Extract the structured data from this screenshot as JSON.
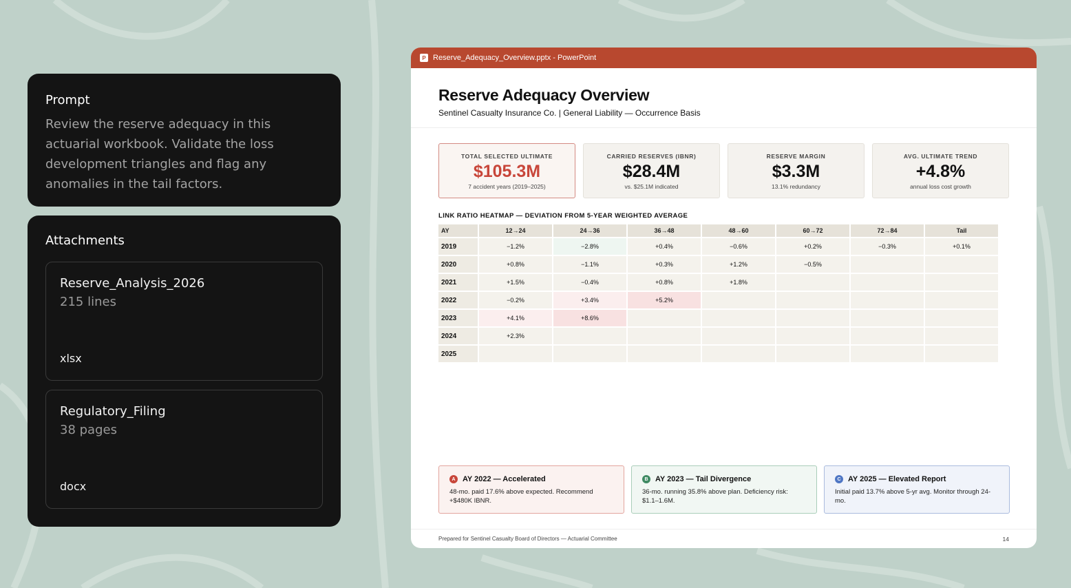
{
  "prompt": {
    "label": "Prompt",
    "text": "Review the reserve adequacy in this actuarial workbook. Validate the loss development triangles and flag any anomalies in the tail factors."
  },
  "attachments": {
    "label": "Attachments",
    "items": [
      {
        "name": "Reserve_Analysis_2026",
        "meta": "215 lines",
        "ext": "xlsx"
      },
      {
        "name": "Regulatory_Filing",
        "meta": "38 pages",
        "ext": "docx"
      }
    ]
  },
  "window": {
    "icon_letter": "P",
    "title": "Reserve_Adequacy_Overview.pptx - PowerPoint"
  },
  "slide": {
    "title": "Reserve Adequacy Overview",
    "subtitle": "Sentinel Casualty Insurance Co.  |  General Liability — Occurrence Basis",
    "kpis": [
      {
        "label": "TOTAL SELECTED ULTIMATE",
        "value": "$105.3M",
        "note": "7 accident years (2019–2025)"
      },
      {
        "label": "CARRIED RESERVES (IBNR)",
        "value": "$28.4M",
        "note": "vs. $25.1M indicated"
      },
      {
        "label": "RESERVE MARGIN",
        "value": "$3.3M",
        "note": "13.1% redundancy"
      },
      {
        "label": "AVG. ULTIMATE TREND",
        "value": "+4.8%",
        "note": "annual loss cost growth"
      }
    ],
    "heatmap": {
      "title": "LINK RATIO HEATMAP — DEVIATION FROM 5-YEAR WEIGHTED AVERAGE",
      "row_header": "AY",
      "columns": [
        "12→24",
        "24→36",
        "36→48",
        "48→60",
        "60→72",
        "72→84",
        "Tail"
      ],
      "rows": [
        {
          "ay": "2019",
          "cells": [
            "−1.2%",
            "−2.8%",
            "+0.4%",
            "−0.6%",
            "+0.2%",
            "−0.3%",
            "+0.1%"
          ]
        },
        {
          "ay": "2020",
          "cells": [
            "+0.8%",
            "−1.1%",
            "+0.3%",
            "+1.2%",
            "−0.5%",
            "",
            ""
          ]
        },
        {
          "ay": "2021",
          "cells": [
            "+1.5%",
            "−0.4%",
            "+0.8%",
            "+1.8%",
            "",
            "",
            ""
          ]
        },
        {
          "ay": "2022",
          "cells": [
            "−0.2%",
            "+3.4%",
            "+5.2%",
            "",
            "",
            "",
            ""
          ]
        },
        {
          "ay": "2023",
          "cells": [
            "+4.1%",
            "+8.6%",
            "",
            "",
            "",
            "",
            ""
          ]
        },
        {
          "ay": "2024",
          "cells": [
            "+2.3%",
            "",
            "",
            "",
            "",
            "",
            ""
          ]
        },
        {
          "ay": "2025",
          "cells": [
            "",
            "",
            "",
            "",
            "",
            "",
            ""
          ]
        }
      ]
    },
    "callouts": [
      {
        "badge": "A",
        "title": "AY 2022 — Accelerated",
        "body": "48-mo. paid 17.6% above expected. Recommend +$480K IBNR."
      },
      {
        "badge": "B",
        "title": "AY 2023 — Tail Divergence",
        "body": "36-mo. running 35.8% above plan. Deficiency risk: $1.1–1.6M."
      },
      {
        "badge": "C",
        "title": "AY 2025 — Elevated Report",
        "body": "Initial paid 13.7% above 5-yr avg. Monitor through 24-mo."
      }
    ],
    "footer": "Prepared for Sentinel Casualty Board of Directors — Actuarial Committee",
    "page_number": "14"
  }
}
